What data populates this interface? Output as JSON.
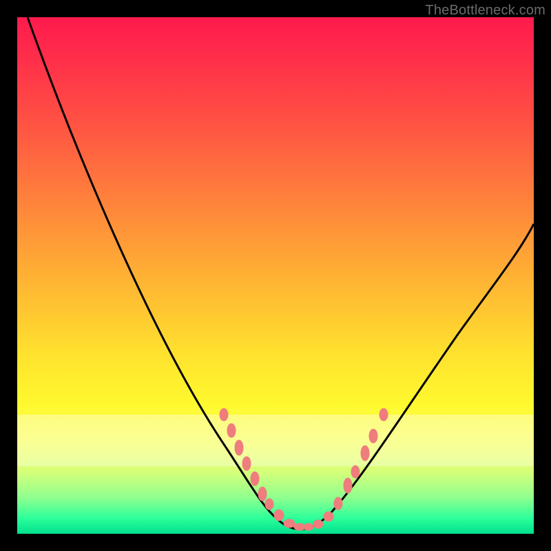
{
  "watermark": "TheBottleneck.com",
  "chart_data": {
    "type": "line",
    "title": "",
    "xlabel": "",
    "ylabel": "",
    "xlim": [
      0,
      100
    ],
    "ylim": [
      0,
      100
    ],
    "grid": false,
    "legend": false,
    "series": [
      {
        "name": "curve",
        "color": "#000000",
        "x": [
          2,
          6,
          10,
          14,
          18,
          22,
          26,
          30,
          34,
          38,
          42,
          44,
          46,
          48,
          50,
          52,
          54,
          56,
          58,
          60,
          62,
          66,
          70,
          74,
          78,
          82,
          86,
          90,
          94,
          98,
          100
        ],
        "y": [
          100,
          92,
          84,
          76,
          68,
          60,
          52,
          44,
          36,
          28,
          19,
          15,
          11,
          7,
          4,
          2,
          1,
          1,
          2,
          4,
          7,
          13,
          19,
          25,
          31,
          36,
          42,
          47,
          52,
          57,
          60
        ]
      },
      {
        "name": "dots",
        "color": "#f07878",
        "marker": "dot",
        "x": [
          40,
          41.5,
          43,
          44.5,
          46,
          47.5,
          48.5,
          50.5,
          52.5,
          54.5,
          56,
          58,
          60,
          62,
          64,
          65.5,
          67.5,
          69,
          71
        ],
        "y": [
          23,
          20,
          17,
          14,
          11,
          8,
          6,
          4,
          2,
          1.5,
          1.5,
          2,
          3.5,
          6,
          9.5,
          12,
          16,
          19,
          23
        ]
      }
    ],
    "bands": [
      {
        "name": "pale-band",
        "y_from": 13,
        "y_to": 23,
        "opacity": 0.35
      }
    ]
  }
}
